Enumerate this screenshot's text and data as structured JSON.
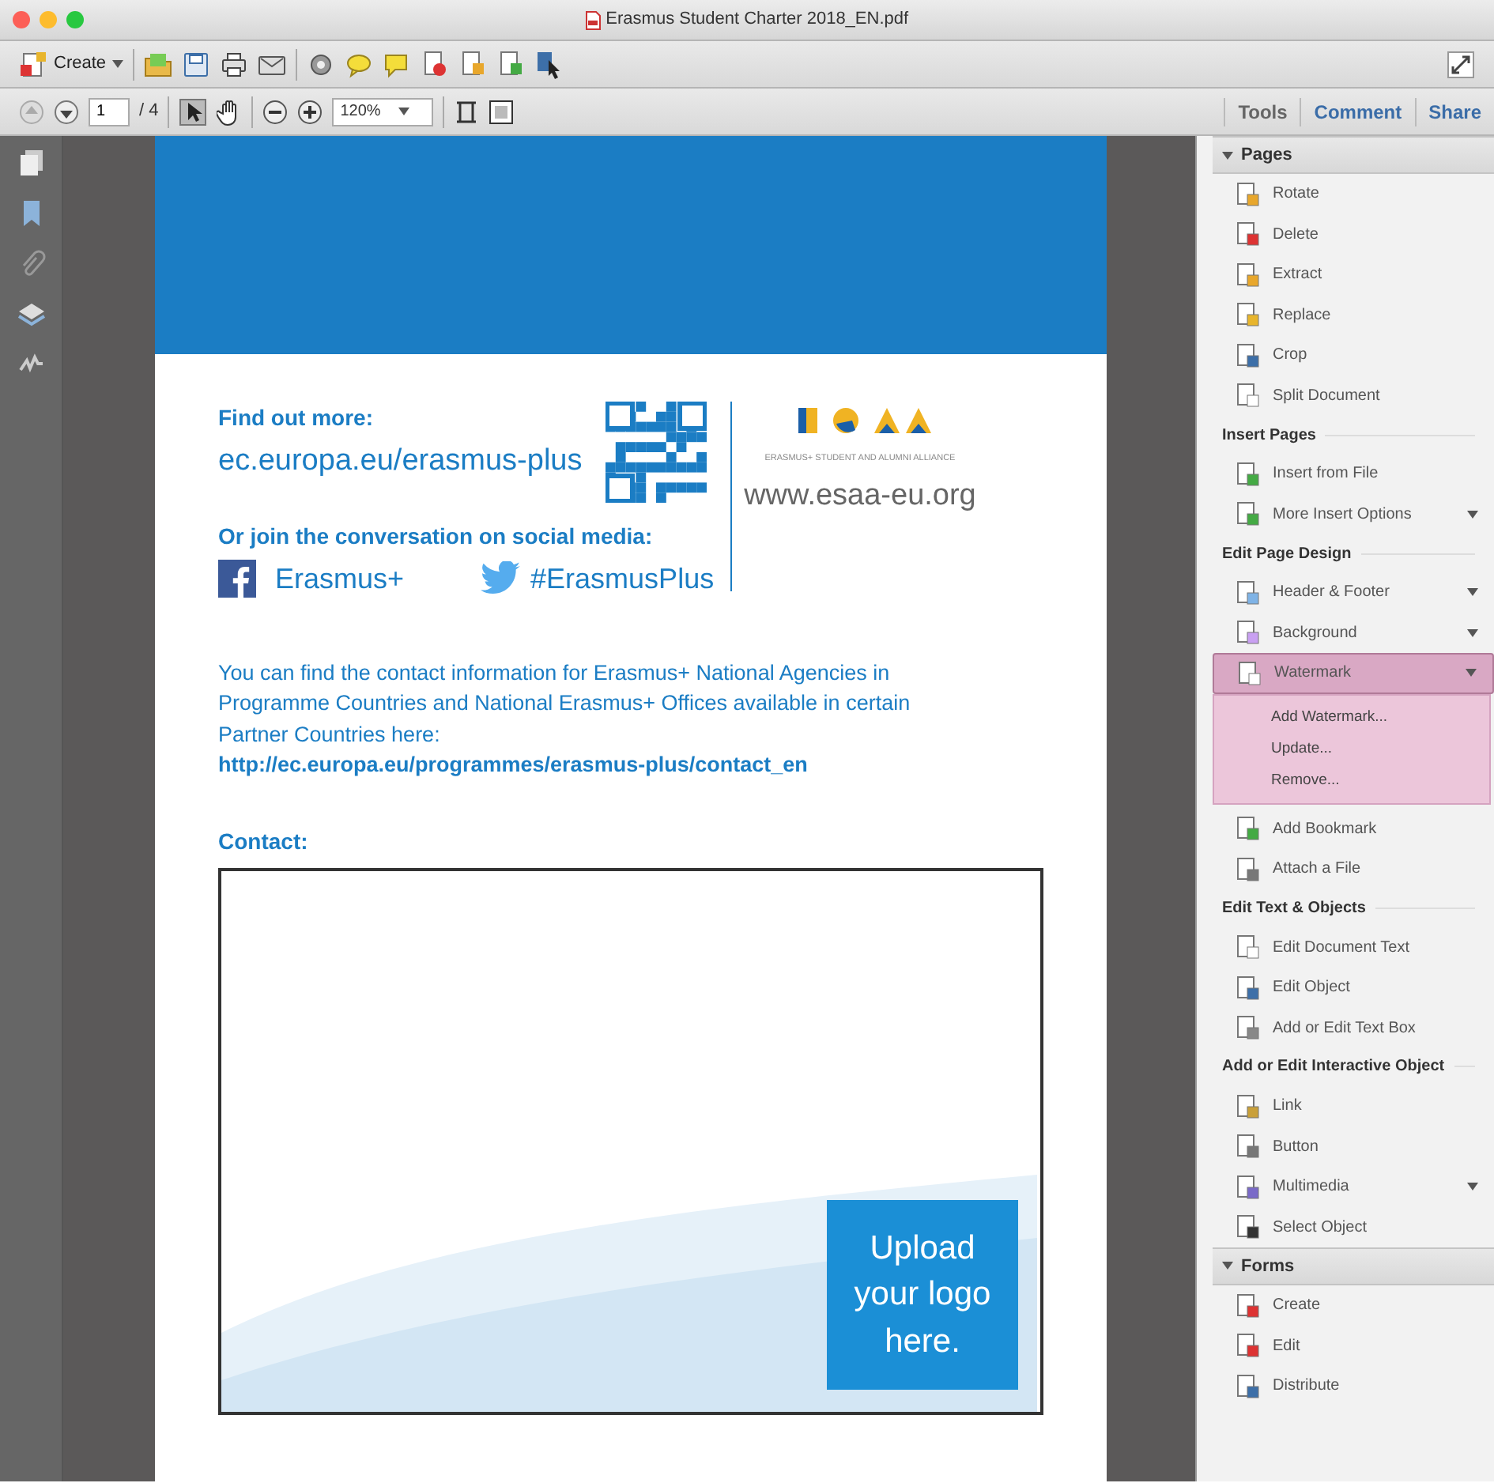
{
  "window": {
    "title": "Erasmus Student Charter 2018_EN.pdf"
  },
  "toolbar": {
    "create_label": "Create",
    "page_number": "1",
    "page_total": "/ 4",
    "zoom": "120%"
  },
  "panel_tabs": [
    {
      "label": "Tools",
      "selected": true
    },
    {
      "label": "Comment",
      "selected": false
    },
    {
      "label": "Share",
      "selected": false
    }
  ],
  "document": {
    "find_heading": "Find out more:",
    "find_url": "ec.europa.eu/erasmus-plus",
    "social_heading": "Or join the conversation on social media:",
    "facebook": "Erasmus+",
    "twitter": "#ErasmusPlus",
    "esaa_caption": "ERASMUS+ STUDENT AND ALUMNI ALLIANCE",
    "esaa_url": "www.esaa-eu.org",
    "paragraph": "You can find the contact information for Erasmus+ National Agencies in Programme Countries and National Erasmus+ Offices available in certain Partner Countries here:",
    "contact_link": "http://ec.europa.eu/programmes/erasmus-plus/contact_en",
    "contact_heading": "Contact:",
    "logo_placeholder": "Upload your logo here."
  },
  "tools_panel": [
    {
      "kind": "header",
      "title": "Pages",
      "expanded": true,
      "items": [
        {
          "label": "Rotate",
          "dropdown": false
        },
        {
          "label": "Delete",
          "dropdown": false
        },
        {
          "label": "Extract",
          "dropdown": false
        },
        {
          "label": "Replace",
          "dropdown": false
        },
        {
          "label": "Crop",
          "dropdown": false
        },
        {
          "label": "Split Document",
          "dropdown": false
        }
      ]
    },
    {
      "kind": "subheading",
      "title": "Insert Pages",
      "items": [
        {
          "label": "Insert from File",
          "dropdown": false
        },
        {
          "label": "More Insert Options",
          "dropdown": true
        }
      ]
    },
    {
      "kind": "subheading",
      "title": "Edit Page Design",
      "items": [
        {
          "label": "Header & Footer",
          "dropdown": true
        },
        {
          "label": "Background",
          "dropdown": true
        },
        {
          "label": "Watermark",
          "dropdown": true,
          "open": true,
          "menu": [
            "Add Watermark...",
            "Update...",
            "Remove..."
          ]
        }
      ]
    },
    {
      "kind": "plain",
      "items": [
        {
          "label": "Add Bookmark",
          "dropdown": false
        },
        {
          "label": "Attach a File",
          "dropdown": false
        }
      ]
    },
    {
      "kind": "subheading",
      "title": "Edit Text & Objects",
      "items": [
        {
          "label": "Edit Document Text",
          "dropdown": false
        },
        {
          "label": "Edit Object",
          "dropdown": false
        },
        {
          "label": "Add or Edit Text Box",
          "dropdown": false
        }
      ]
    },
    {
      "kind": "subheading",
      "title": "Add or Edit Interactive Object",
      "items": [
        {
          "label": "Link",
          "dropdown": false
        },
        {
          "label": "Button",
          "dropdown": false
        },
        {
          "label": "Multimedia",
          "dropdown": true
        },
        {
          "label": "Select Object",
          "dropdown": false
        }
      ]
    },
    {
      "kind": "header",
      "title": "Forms",
      "expanded": true,
      "items": [
        {
          "label": "Create",
          "dropdown": false
        },
        {
          "label": "Edit",
          "dropdown": false
        },
        {
          "label": "Distribute",
          "dropdown": false
        }
      ]
    }
  ]
}
